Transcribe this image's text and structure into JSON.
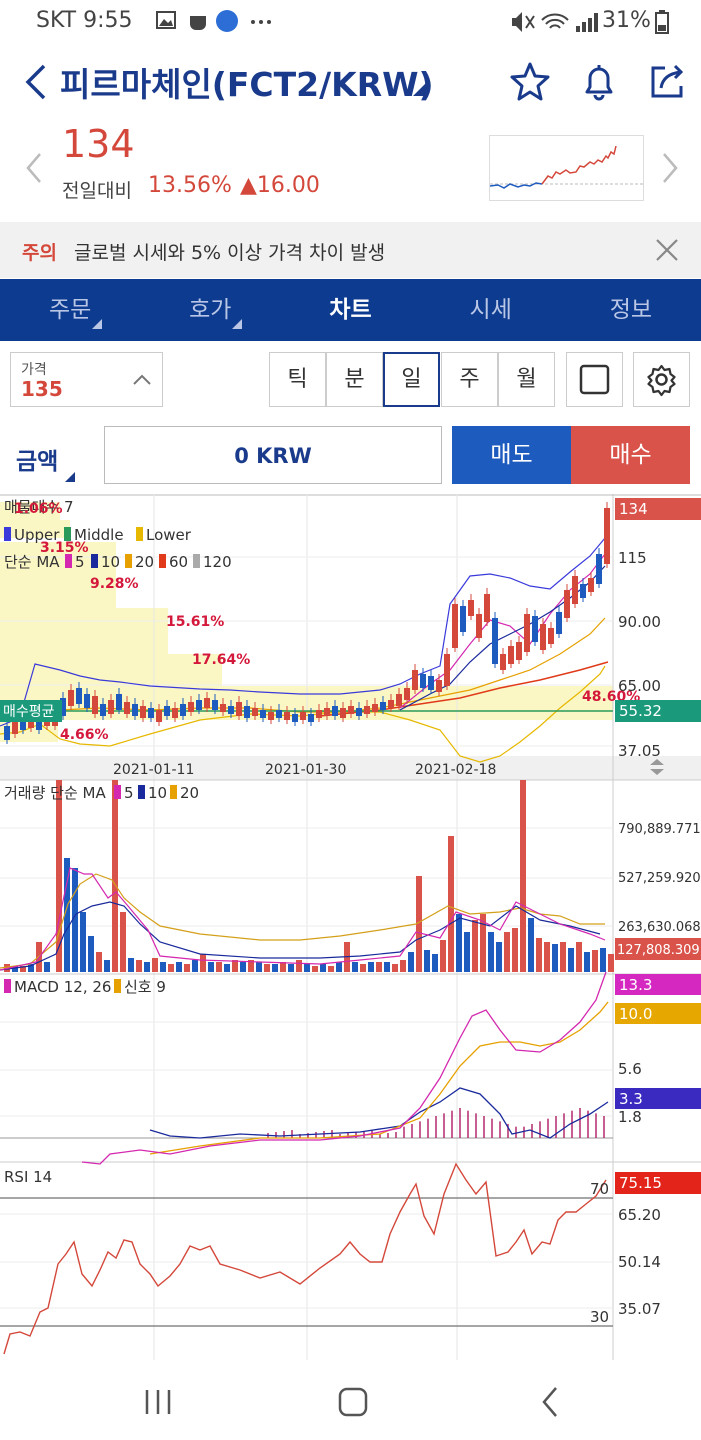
{
  "status": {
    "carrier_time": "SKT 9:55",
    "battery": "31%"
  },
  "header": {
    "title": "피르마체인(FCT2/KRW)"
  },
  "price": {
    "current": "134",
    "change_label": "전일대비",
    "change_pct": "13.56%",
    "change_amt": "▲16.00"
  },
  "notice": {
    "tag": "주의",
    "message": "글로벌 시세와 5% 이상 가격 차이 발생"
  },
  "tabs": [
    {
      "label": "주문",
      "has_sub": true
    },
    {
      "label": "호가",
      "has_sub": true
    },
    {
      "label": "차트",
      "has_sub": false,
      "active": true
    },
    {
      "label": "시세",
      "has_sub": false
    },
    {
      "label": "정보",
      "has_sub": false
    }
  ],
  "controls": {
    "price_label": "가격",
    "price_value": "135",
    "periods": [
      "틱",
      "분",
      "일",
      "주",
      "월"
    ],
    "active_period": "일"
  },
  "order": {
    "amount_label": "금액",
    "amount_value": "0 KRW",
    "sell_label": "매도",
    "buy_label": "매수"
  },
  "chart_data": [
    {
      "type": "candlestick",
      "title": "매물대수 7",
      "legend_line2": [
        "Upper",
        "Middle",
        "Lower"
      ],
      "legend_line3_prefix": "단순 MA",
      "ma_periods": [
        "5",
        "10",
        "20",
        "60",
        "120"
      ],
      "y_ticks": [
        "115",
        "90.00",
        "65.00",
        "37.05"
      ],
      "current_price_label": "134",
      "avg_buy_label": "매수평균",
      "avg_buy_value": "55.32",
      "x_ticks": [
        "2021-01-11",
        "2021-01-30",
        "2021-02-18"
      ],
      "volume_profile_pcts": [
        "1.06%",
        "3.15%",
        "9.28%",
        "15.61%",
        "17.64%",
        "48.60%",
        "4.66%"
      ],
      "colors": {
        "up": "#d4483b",
        "down": "#1e5bbf",
        "upper": "#3a3adb",
        "middle": "#2a9a5a",
        "lower": "#e6b800"
      }
    },
    {
      "type": "bar",
      "title": "거래량 단순 MA",
      "ma_periods": [
        "5",
        "10",
        "20"
      ],
      "y_ticks": [
        "790,889.771",
        "527,259.920",
        "263,630.068"
      ],
      "current_label": "127,808.309"
    },
    {
      "type": "line",
      "title": "MACD 12, 26",
      "signal_label": "신호 9",
      "y_ticks": [
        "5.6",
        "1.8"
      ],
      "macd_value": "13.3",
      "signal_value": "10.0",
      "osc_value": "3.3"
    },
    {
      "type": "line",
      "title": "RSI 14",
      "y_ticks": [
        "65.20",
        "50.14",
        "35.07"
      ],
      "current_value": "75.15",
      "upper_level": "70",
      "lower_level": "30"
    }
  ]
}
